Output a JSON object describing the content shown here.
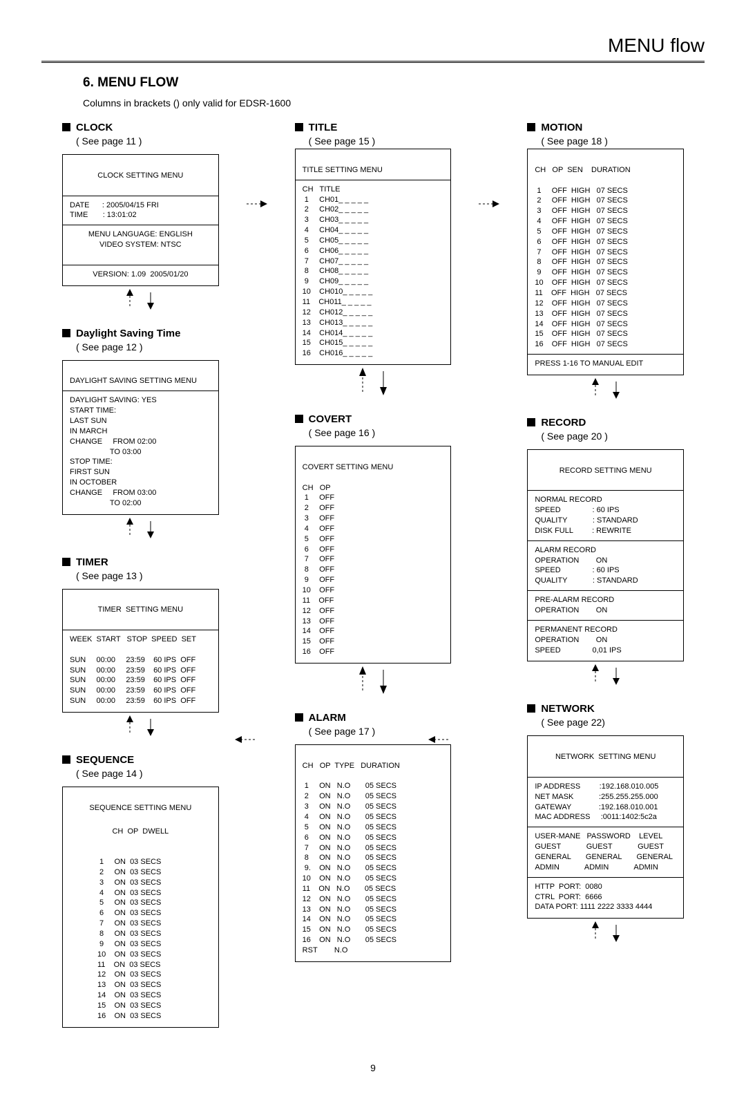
{
  "header": "MENU flow",
  "section_num_title": "6. MENU FLOW",
  "note": "Columns in brackets () only valid for EDSR-1600",
  "page_number": "9",
  "clock": {
    "title": "CLOCK",
    "sub": "( See page 11 )",
    "menu_title": "CLOCK SETTING MENU",
    "date_label": "DATE",
    "date_value": ": 2005/04/15 FRI",
    "time_label": "TIME",
    "time_value": ": 13:01:02",
    "lang_label": "MENU LANGUAGE: ENGLISH",
    "video_label": "VIDEO SYSTEM: NTSC",
    "version_label": "VERSION: 1.09  2005/01/20"
  },
  "dst": {
    "title": "Daylight Saving Time",
    "sub": "( See page 12 )",
    "menu_title": "DAYLIGHT SAVING SETTING MENU",
    "l1": "DAYLIGHT SAVING: YES",
    "l2": "START TIME:",
    "l3": "LAST SUN",
    "l4": "IN MARCH",
    "l5": "CHANGE     FROM 02:00",
    "l6": "                   TO 03:00",
    "l7": "STOP TIME:",
    "l8": "FIRST SUN",
    "l9": "IN OCTOBER",
    "l10": "CHANGE     FROM 03:00",
    "l11": "                   TO 02:00"
  },
  "timer": {
    "title": "TIMER",
    "sub": "( See page 13 )",
    "menu_title": "TIMER  SETTING MENU",
    "header_row": "WEEK  START   STOP  SPEED  SET",
    "rows": [
      "SUN     00:00     23:59    60 IPS  OFF",
      "SUN     00:00     23:59    60 IPS  OFF",
      "SUN     00:00     23:59    60 IPS  OFF",
      "SUN     00:00     23:59    60 IPS  OFF",
      "SUN     00:00     23:59    60 IPS  OFF"
    ]
  },
  "sequence": {
    "title": "SEQUENCE",
    "sub": "( See page 14 )",
    "menu_title": "SEQUENCE SETTING MENU",
    "header_row": "CH  OP  DWELL",
    "rows": [
      " 1     ON  03 SECS",
      " 2     ON  03 SECS",
      " 3     ON  03 SECS",
      " 4     ON  03 SECS",
      " 5     ON  03 SECS",
      " 6     ON  03 SECS",
      " 7     ON  03 SECS",
      " 8     ON  03 SECS",
      " 9     ON  03 SECS",
      "10    ON  03 SECS",
      "11    ON  03 SECS",
      "12    ON  03 SECS",
      "13    ON  03 SECS",
      "14    ON  03 SECS",
      "15    ON  03 SECS",
      "16    ON  03 SECS"
    ]
  },
  "titlebox": {
    "title": "TITLE",
    "sub": "( See page 15 )",
    "menu_title": "TITLE SETTING MENU",
    "header_row": "CH   TITLE",
    "rows": [
      " 1     CH01_ _ _ _ _",
      " 2     CH02_ _ _ _ _",
      " 3     CH03_ _ _ _ _",
      " 4     CH04_ _ _ _ _",
      " 5     CH05_ _ _ _ _",
      " 6     CH06_ _ _ _ _",
      " 7     CH07_ _ _ _ _",
      " 8     CH08_ _ _ _ _",
      " 9     CH09_ _ _ _ _",
      "10    CH010_ _ _ _ _",
      "11    CH011_ _ _ _ _",
      "12    CH012_ _ _ _ _",
      "13    CH013_ _ _ _ _",
      "14    CH014_ _ _ _ _",
      "15    CH015_ _ _ _ _",
      "16    CH016_ _ _ _ _"
    ]
  },
  "covert": {
    "title": "COVERT",
    "sub": "( See page 16 )",
    "menu_title": "COVERT SETTING MENU",
    "header_row": "CH   OP",
    "rows": [
      " 1     OFF",
      " 2     OFF",
      " 3     OFF",
      " 4     OFF",
      " 5     OFF",
      " 6     OFF",
      " 7     OFF",
      " 8     OFF",
      " 9     OFF",
      "10    OFF",
      "11    OFF",
      "12    OFF",
      "13    OFF",
      "14    OFF",
      "15    OFF",
      "16    OFF"
    ]
  },
  "alarm": {
    "title": "ALARM",
    "sub": "( See page 17 )",
    "header_row": "CH   OP  TYPE   DURATION",
    "rows": [
      " 1     ON   N.O       05 SECS",
      " 2     ON   N.O       05 SECS",
      " 3     ON   N.O       05 SECS",
      " 4     ON   N.O       05 SECS",
      " 5     ON   N.O       05 SECS",
      " 6     ON   N.O       05 SECS",
      " 7     ON   N.O       05 SECS",
      " 8     ON   N.O       05 SECS",
      " 9.    ON   N.O       05 SECS",
      "10    ON   N.O       05 SECS",
      "11    ON   N.O       05 SECS",
      "12    ON   N.O       05 SECS",
      "13    ON   N.O       05 SECS",
      "14    ON   N.O       05 SECS",
      "15    ON   N.O       05 SECS",
      "16    ON   N.O       05 SECS",
      "RST        N.O"
    ]
  },
  "motion": {
    "title": "MOTION",
    "sub": "( See page 18 )",
    "header_row": "CH   OP  SEN    DURATION",
    "rows": [
      " 1     OFF  HIGH   07 SECS",
      " 2     OFF  HIGH   07 SECS",
      " 3     OFF  HIGH   07 SECS",
      " 4     OFF  HIGH   07 SECS",
      " 5     OFF  HIGH   07 SECS",
      " 6     OFF  HIGH   07 SECS",
      " 7     OFF  HIGH   07 SECS",
      " 8     OFF  HIGH   07 SECS",
      " 9     OFF  HIGH   07 SECS",
      "10    OFF  HIGH   07 SECS",
      "11    OFF  HIGH   07 SECS",
      "12    OFF  HIGH   07 SECS",
      "13    OFF  HIGH   07 SECS",
      "14    OFF  HIGH   07 SECS",
      "15    OFF  HIGH   07 SECS",
      "16    OFF  HIGH   07 SECS"
    ],
    "footer": "PRESS 1-16 TO MANUAL EDIT"
  },
  "record": {
    "title": "RECORD",
    "sub": "( See page 20 )",
    "menu_title": "RECORD SETTING MENU",
    "sec1_title": "NORMAL RECORD",
    "sec1_rows": [
      "SPEED               : 60 IPS",
      "QUALITY            : STANDARD",
      "DISK FULL         : REWRITE"
    ],
    "sec2_title": "ALARM RECORD",
    "sec2_rows": [
      "OPERATION        ON",
      "SPEED               : 60 IPS",
      "QUALITY            : STANDARD"
    ],
    "sec3_title": "PRE-ALARM RECORD",
    "sec3_rows": [
      "OPERATION        ON"
    ],
    "sec4_title": "PERMANENT RECORD",
    "sec4_rows": [
      "OPERATION        ON",
      "SPEED               0,01 IPS"
    ]
  },
  "network": {
    "title": "NETWORK",
    "sub": "( See page 22)",
    "menu_title": "NETWORK  SETTING MENU",
    "r1": "IP ADDRESS         :192.168.010.005",
    "r2": "NET MASK            :255.255.255.000",
    "r3": "GATEWAY             :192.168.010.001",
    "r4": "MAC ADDRESS     :0011:1402:5c2a",
    "uhead": "USER-MANE   PASSWORD    LEVEL",
    "u1": "GUEST            GUEST            GUEST",
    "u2": "GENERAL       GENERAL       GENERAL",
    "u3": "ADMIN            ADMIN            ADMIN",
    "p1": "HTTP  PORT:  0080",
    "p2": "CTRL  PORT:  6666",
    "p3": "DATA PORT: 1111 2222 3333 4444"
  }
}
